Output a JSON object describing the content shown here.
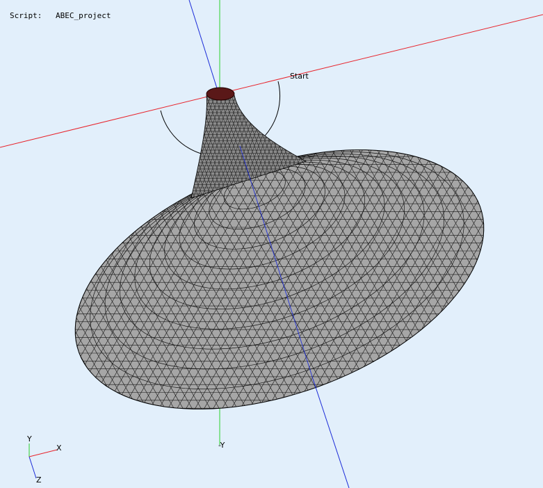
{
  "header": {
    "script_label": "Script:",
    "script_name": "ABEC_project"
  },
  "viewport": {
    "start_label": "Start",
    "neg_y_label": "-Y",
    "triad": {
      "x": "X",
      "y": "Y",
      "z": "Z"
    }
  },
  "colors": {
    "background": "#e2effb",
    "x_axis": "#e8232b",
    "y_axis": "#2bd12b",
    "z_axis": "#1a2ad8",
    "mesh_fill": "#a6a6a6",
    "mesh_lines": "#141414",
    "throat": "#5a1818"
  }
}
